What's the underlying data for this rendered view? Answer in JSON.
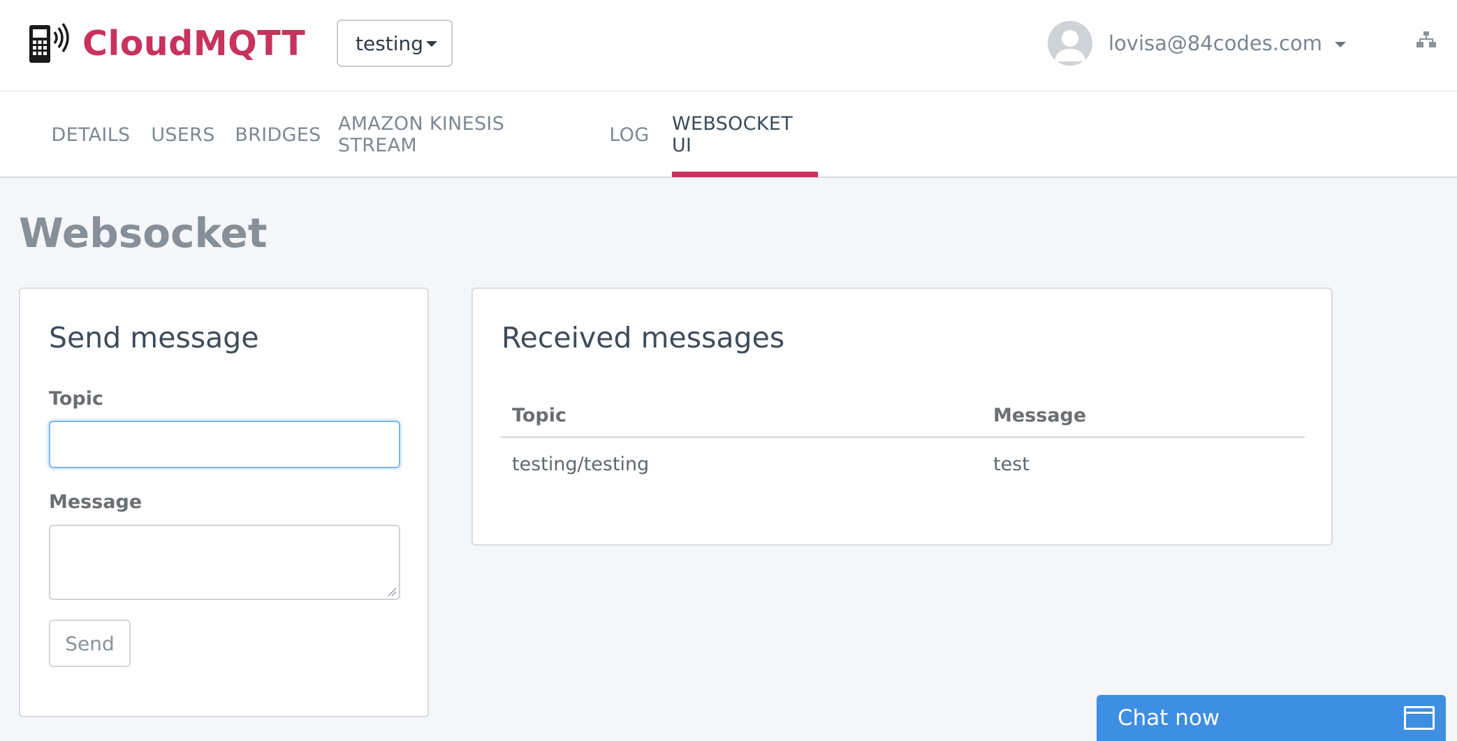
{
  "header": {
    "brand": "CloudMQTT",
    "instance": "testing",
    "user_email": "lovisa@84codes.com"
  },
  "tabs": [
    {
      "label": "DETAILS"
    },
    {
      "label": "USERS"
    },
    {
      "label": "BRIDGES"
    },
    {
      "label": "AMAZON KINESIS STREAM"
    },
    {
      "label": "LOG"
    },
    {
      "label": "WEBSOCKET UI"
    }
  ],
  "active_tab": "WEBSOCKET UI",
  "page": {
    "title": "Websocket"
  },
  "send": {
    "title": "Send message",
    "topic_label": "Topic",
    "topic_value": "",
    "message_label": "Message",
    "message_value": "",
    "button": "Send"
  },
  "received": {
    "title": "Received messages",
    "columns": [
      "Topic",
      "Message"
    ],
    "rows": [
      [
        "testing/testing",
        "test"
      ]
    ]
  },
  "chat": {
    "label": "Chat now"
  },
  "colors": {
    "brand": "#c7335d",
    "chat": "#3e8ee2",
    "background": "#f4f6fa"
  }
}
